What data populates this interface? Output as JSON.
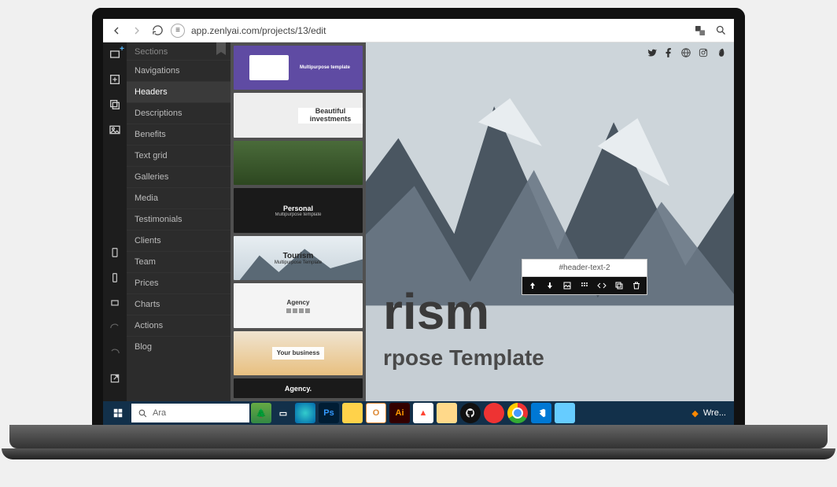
{
  "browser": {
    "url": "app.zenlyai.com/projects/13/edit"
  },
  "sidebar": {
    "title": "Sections",
    "items": [
      "Navigations",
      "Headers",
      "Descriptions",
      "Benefits",
      "Text grid",
      "Galleries",
      "Media",
      "Testimonials",
      "Clients",
      "Team",
      "Prices",
      "Charts",
      "Actions",
      "Blog"
    ],
    "active_index": 1
  },
  "templates": [
    {
      "title": "Multipurpose template",
      "variant": "purple"
    },
    {
      "title": "Beautiful investments",
      "variant": "split"
    },
    {
      "title": "",
      "variant": "green"
    },
    {
      "title": "Personal",
      "subtitle": "Multipurpose template",
      "variant": "dark"
    },
    {
      "title": "Tourism",
      "subtitle": "Multipurpose Template",
      "variant": "mountain"
    },
    {
      "title": "Agency",
      "variant": "agency"
    },
    {
      "title": "Your business",
      "variant": "orange"
    },
    {
      "title": "Agency.",
      "variant": "dark"
    }
  ],
  "canvas": {
    "hero_title_fragment": "rism",
    "hero_subtitle_fragment": "rpose Template",
    "element_label": "#header-text-2"
  },
  "taskbar": {
    "search_placeholder": "Ara",
    "right_label": "Wre..."
  }
}
